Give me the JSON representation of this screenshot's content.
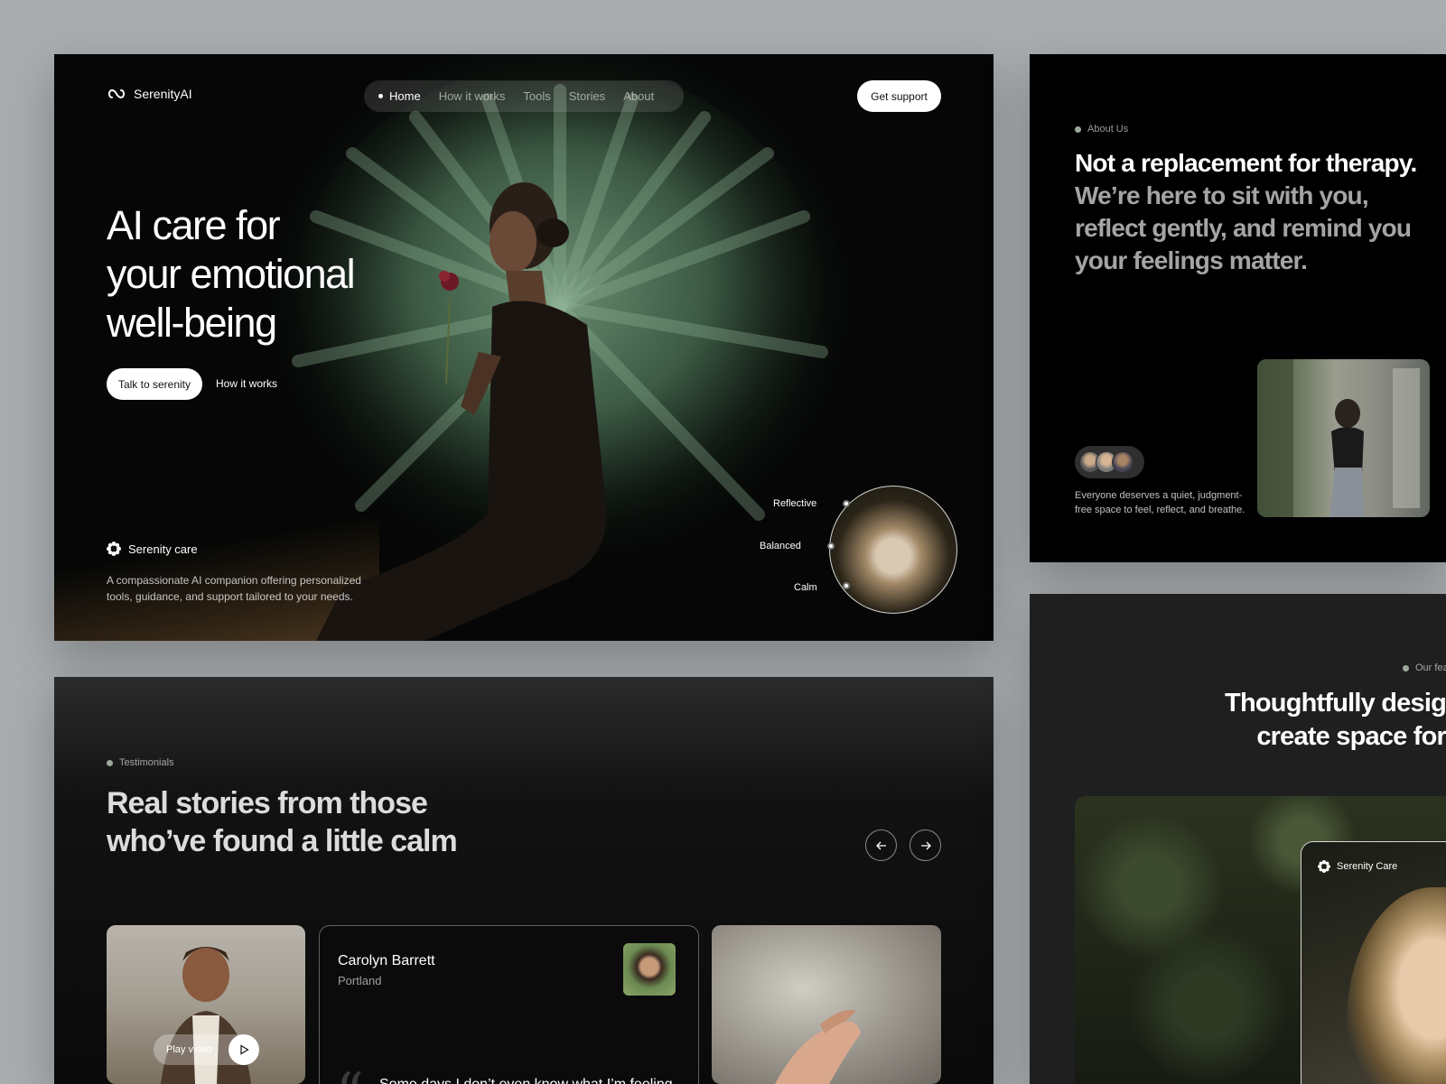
{
  "hero": {
    "brand": "SerenityAI",
    "nav": [
      "Home",
      "How it works",
      "Tools",
      "Stories",
      "About"
    ],
    "cta": "Get support",
    "title_lines": [
      "AI care for",
      "your emotional",
      "well-being"
    ],
    "primary_button": "Talk to serenity",
    "secondary_link": "How it works",
    "care_title": "Serenity care",
    "care_desc_line1": "A compassionate AI companion offering personalized",
    "care_desc_line2": "tools, guidance, and support tailored to your needs.",
    "moods": [
      "Reflective",
      "Balanced",
      "Calm"
    ]
  },
  "about": {
    "label": "About Us",
    "title_highlight": "Not a replacement for therapy.",
    "title_rest": "We’re here to sit with you, reflect gently, and remind you your feelings matter.",
    "text_line1": "Everyone deserves a quiet, judgment-",
    "text_line2": "free space to feel, reflect, and breathe."
  },
  "testimonials": {
    "label": "Testimonials",
    "title_line1": "Real stories from those",
    "title_line2": "who’ve found a little calm",
    "play_label": "Play video",
    "name": "Carolyn Barrett",
    "city": "Portland",
    "quote": "Some days I don’t even know what I’m feeling"
  },
  "features": {
    "label": "Our fea",
    "title_line1": "Thoughtfully desig",
    "title_line2": "create space for",
    "card_title": "Serenity Care"
  },
  "colors": {
    "page_bg": "#a9adb0",
    "accent_dot": "#9aa89c",
    "panel_dark": "#000000"
  }
}
